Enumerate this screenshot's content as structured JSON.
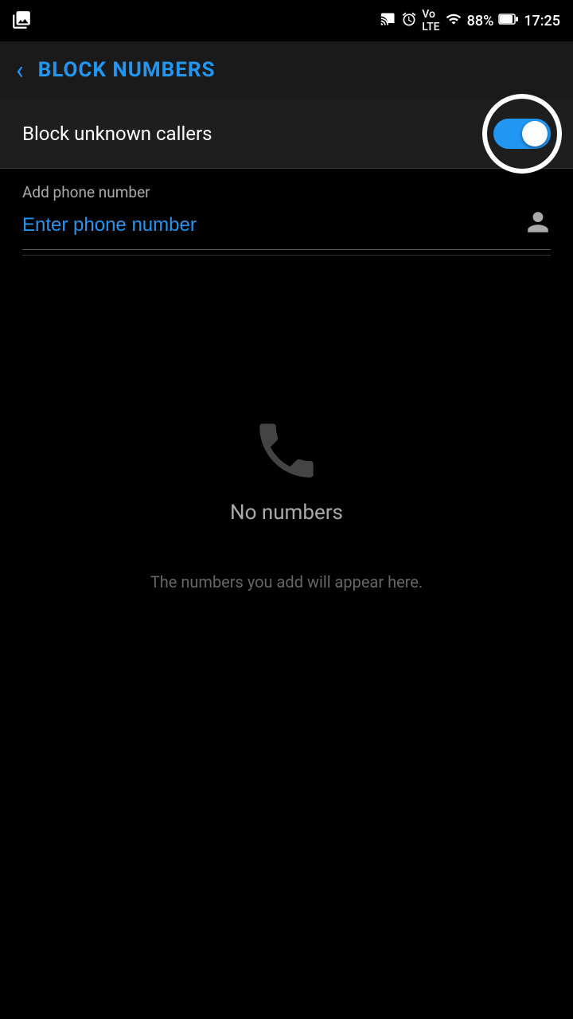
{
  "statusBar": {
    "time": "17:25",
    "battery": "88%",
    "icons": [
      "cast",
      "alarm",
      "volte",
      "signal",
      "battery"
    ]
  },
  "appBar": {
    "backLabel": "‹",
    "title": "BLOCK NUMBERS"
  },
  "blockUnknownCallers": {
    "label": "Block unknown callers",
    "toggleEnabled": true
  },
  "addPhoneNumber": {
    "sectionLabel": "Add phone number",
    "inputPlaceholder": "Enter phone number"
  },
  "emptyState": {
    "noNumbersLabel": "No numbers",
    "hintText": "The numbers you add will appear here."
  }
}
